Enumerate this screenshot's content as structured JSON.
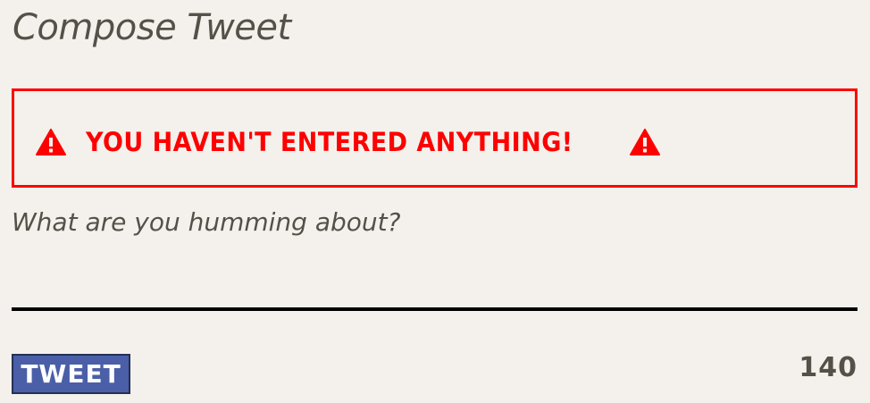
{
  "compose": {
    "title": "Compose Tweet"
  },
  "error": {
    "message": "You haven't entered anything!",
    "icon": "warning-icon",
    "color": "#ff0000"
  },
  "tweet_input": {
    "placeholder": "What are you humming about?",
    "value": ""
  },
  "actions": {
    "tweet_label": "TWEET",
    "button_color": "#4a5fa8"
  },
  "counter": {
    "remaining": "140"
  }
}
